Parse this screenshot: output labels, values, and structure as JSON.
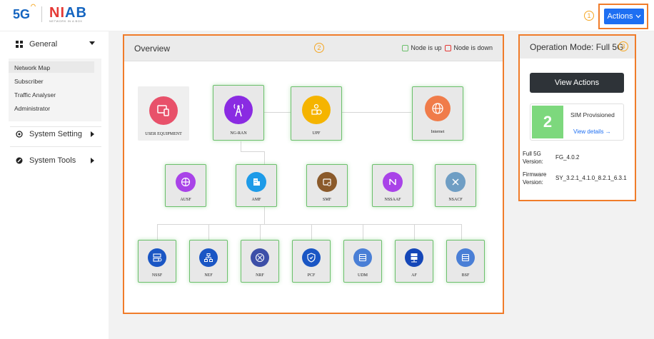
{
  "header": {
    "logo_5g": "5G",
    "logo_niab_a": "NI",
    "logo_niab_b": "AB",
    "logo_tag": "NETWORK IN A BOX",
    "actions_label": "Actions",
    "badge_1": "1",
    "badge_2": "2",
    "badge_3": "3"
  },
  "sidebar": {
    "general": "General",
    "sub_items": [
      "Network Map",
      "Subscriber",
      "Traffic Analyser",
      "Administrator"
    ],
    "system_setting": "System Setting",
    "system_tools": "System Tools"
  },
  "overview": {
    "title": "Overview",
    "legend_up": "Node is up",
    "legend_down": "Node is down",
    "nodes": {
      "ue": "USER EQUIPMENT",
      "ngran": "NG-RAN",
      "upf": "UPF",
      "internet": "Internet",
      "ausf": "AUSF",
      "amf": "AMF",
      "smf": "SMF",
      "nssaaf": "NSSAAF",
      "nsacf": "NSACF",
      "nssf": "NSSF",
      "nef": "NEF",
      "nrf": "NRF",
      "pcf": "PCF",
      "udm": "UDM",
      "af": "AF",
      "bsf": "BSF"
    }
  },
  "operation": {
    "title": "Operation Mode: Full 5G",
    "view_actions": "View Actions",
    "sim_count": "2",
    "sim_label": "SIM Provisioned",
    "view_details": "View details →",
    "full5g_key_1": "Full 5G",
    "full5g_key_2": "Version:",
    "full5g_value": "FG_4.0.2",
    "fw_key_1": "Firmware",
    "fw_key_2": "Version:",
    "fw_value": "SY_3.2.1_4.1.0_8.2.1_6.3.1"
  },
  "colors": {
    "accent": "#1e6ff2",
    "highlight": "#f07c2a",
    "node_up": "#6cc06c",
    "node_down": "#e53935"
  }
}
